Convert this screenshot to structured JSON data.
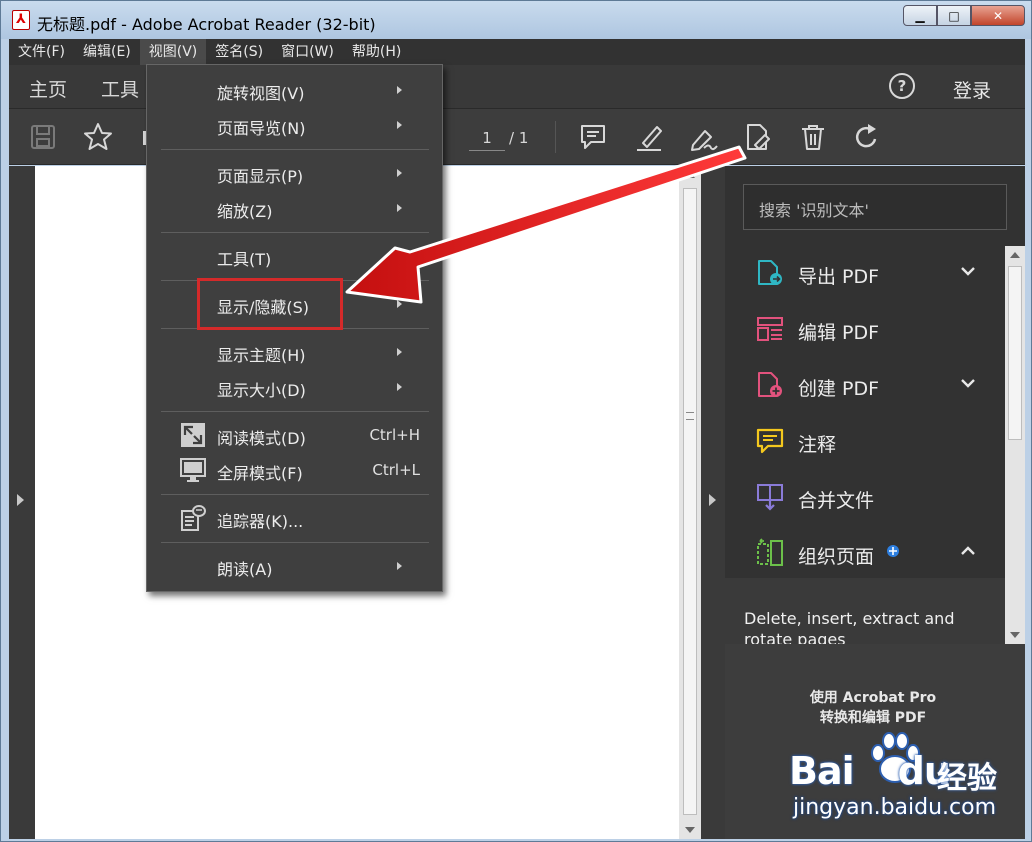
{
  "window": {
    "title": "无标题.pdf - Adobe Acrobat Reader (32-bit)",
    "minimize": "▁",
    "maximize": "□",
    "close": "✕"
  },
  "menubar": {
    "items": [
      "文件(F)",
      "编辑(E)",
      "视图(V)",
      "签名(S)",
      "窗口(W)",
      "帮助(H)"
    ]
  },
  "tabs": {
    "home": "主页",
    "tools": "工具",
    "help": "?",
    "login": "登录"
  },
  "toolbar": {
    "page_current": "1",
    "page_total": "/ 1"
  },
  "view_menu": {
    "rotate": "旋转视图(V)",
    "page_nav": "页面导览(N)",
    "page_display": "页面显示(P)",
    "zoom": "缩放(Z)",
    "tools": "工具(T)",
    "show_hide": "显示/隐藏(S)",
    "theme": "显示主题(H)",
    "size": "显示大小(D)",
    "read_mode": "阅读模式(D)",
    "read_mode_shortcut": "Ctrl+H",
    "full_screen": "全屏模式(F)",
    "full_screen_shortcut": "Ctrl+L",
    "tracker": "追踪器(K)...",
    "read_aloud": "朗读(A)"
  },
  "right_pane": {
    "search_placeholder": "搜索 '识别文本'",
    "tools": [
      {
        "label": "导出 PDF",
        "color": "#2fb7c4"
      },
      {
        "label": "编辑 PDF",
        "color": "#e2527d"
      },
      {
        "label": "创建 PDF",
        "color": "#e2527d"
      },
      {
        "label": "注释",
        "color": "#f4c81e"
      },
      {
        "label": "合并文件",
        "color": "#8a7bd8"
      },
      {
        "label": "组织页面",
        "color": "#6cc04a"
      }
    ],
    "description": "Delete, insert, extract and rotate pages",
    "promo": "使用 Acrobat Pro\n转换和编辑 PDF"
  },
  "watermark": {
    "brand": "Bai",
    "brand2": "du",
    "suffix": "经验",
    "url": "jingyan.baidu.com"
  },
  "colors": {
    "highlight_box": "#d42a2a",
    "arrow": "#e11b1b"
  }
}
